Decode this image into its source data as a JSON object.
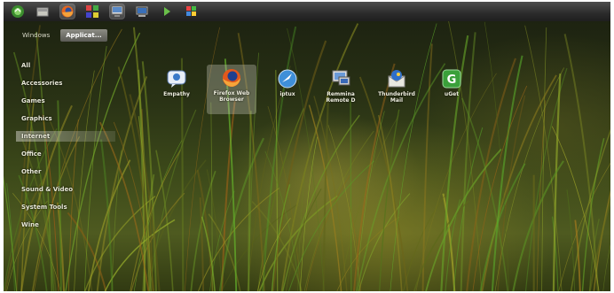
{
  "panel": {
    "icons": [
      {
        "name": "main-menu-icon"
      },
      {
        "name": "show-desktop-icon"
      },
      {
        "name": "firefox-launcher-icon"
      },
      {
        "name": "applications-launcher-icon"
      },
      {
        "name": "file-manager-icon"
      },
      {
        "name": "monitor-icon"
      },
      {
        "name": "play-icon"
      },
      {
        "name": "windows-icon"
      }
    ]
  },
  "view_tabs": [
    {
      "label": "Windows",
      "selected": false
    },
    {
      "label": "Applicat...",
      "selected": true
    }
  ],
  "categories": [
    {
      "label": "All",
      "selected": false
    },
    {
      "label": "Accessories",
      "selected": false
    },
    {
      "label": "Games",
      "selected": false
    },
    {
      "label": "Graphics",
      "selected": false
    },
    {
      "label": "Internet",
      "selected": true
    },
    {
      "label": "Office",
      "selected": false
    },
    {
      "label": "Other",
      "selected": false
    },
    {
      "label": "Sound & Video",
      "selected": false
    },
    {
      "label": "System Tools",
      "selected": false
    },
    {
      "label": "Wine",
      "selected": false
    }
  ],
  "apps": [
    {
      "icon": "empathy-icon",
      "line1": "Empathy",
      "line2": "",
      "selected": false
    },
    {
      "icon": "firefox-icon",
      "line1": "Firefox Web",
      "line2": "Browser",
      "selected": true
    },
    {
      "icon": "iptux-icon",
      "line1": "iptux",
      "line2": "",
      "selected": false
    },
    {
      "icon": "remote-desktop-icon",
      "line1": "Remmina",
      "line2": "Remote D",
      "selected": false
    },
    {
      "icon": "thunderbird-icon",
      "line1": "Thunderbird",
      "line2": "Mail",
      "selected": false
    },
    {
      "icon": "uget-icon",
      "line1": "uGet",
      "line2": "",
      "selected": false
    }
  ]
}
